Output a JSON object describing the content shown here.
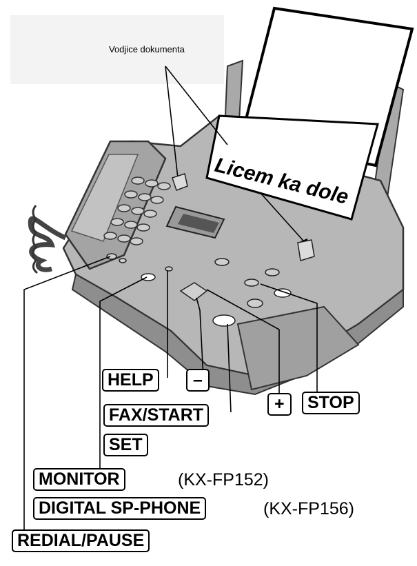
{
  "callouts": {
    "document_guides": "Vodjice dokumenta",
    "face_down": "Licem ka dole"
  },
  "buttons": {
    "help": "HELP",
    "minus": "–",
    "plus": "+",
    "stop": "STOP",
    "fax_start": "FAX/START",
    "set": "SET",
    "monitor": "MONITOR",
    "digital_sp_phone": "DIGITAL SP-PHONE",
    "redial_pause": "REDIAL/PAUSE"
  },
  "models": {
    "monitor_model": "(KX-FP152)",
    "digital_sp_phone_model": "(KX-FP156)"
  }
}
